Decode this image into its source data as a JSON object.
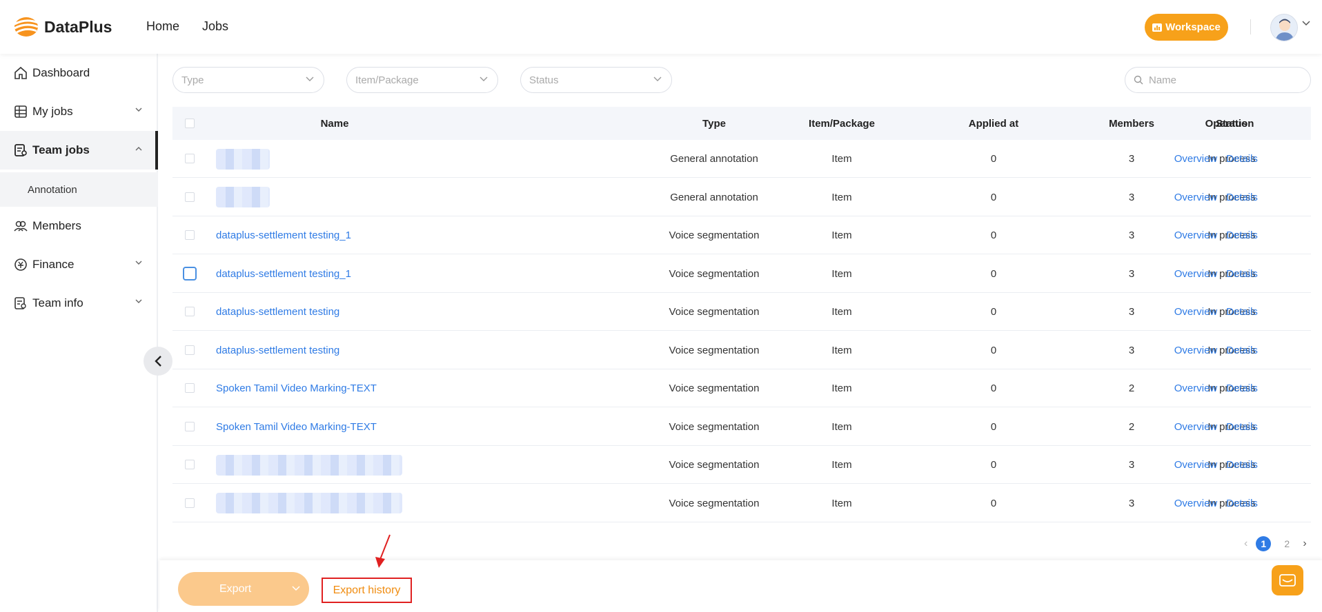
{
  "app": {
    "name": "DataPlus",
    "logo_icon": "dataplus-logo-icon"
  },
  "nav": {
    "home": "Home",
    "jobs": "Jobs"
  },
  "header": {
    "workspace": "Workspace",
    "accent_color": "#f7a11a"
  },
  "sidebar": {
    "dashboard": "Dashboard",
    "my_jobs": "My jobs",
    "team_jobs": "Team jobs",
    "annotation": "Annotation",
    "members": "Members",
    "finance": "Finance",
    "team_info": "Team info"
  },
  "filters": {
    "type": "Type",
    "item_package": "Item/Package",
    "status": "Status",
    "search_placeholder": "Name"
  },
  "table": {
    "headers": {
      "name": "Name",
      "type": "Type",
      "item_package": "Item/Package",
      "applied_at": "Applied at",
      "members": "Members",
      "status": "Status",
      "operation": "Operation"
    },
    "rows": [
      {
        "name": "",
        "type": "General annotation",
        "item": "Item",
        "applied": "0",
        "members": "3",
        "status": "In process",
        "overview": "Overview",
        "details": "Details"
      },
      {
        "name": "",
        "type": "General annotation",
        "item": "Item",
        "applied": "0",
        "members": "3",
        "status": "In process",
        "overview": "Overview",
        "details": "Details"
      },
      {
        "name": "dataplus-settlement testing_1",
        "type": "Voice segmentation",
        "item": "Item",
        "applied": "0",
        "members": "3",
        "status": "In process",
        "overview": "Overview",
        "details": "Details"
      },
      {
        "name": "dataplus-settlement testing_1",
        "type": "Voice segmentation",
        "item": "Item",
        "applied": "0",
        "members": "3",
        "status": "In process",
        "overview": "Overview",
        "details": "Details"
      },
      {
        "name": "dataplus-settlement testing",
        "type": "Voice segmentation",
        "item": "Item",
        "applied": "0",
        "members": "3",
        "status": "In process",
        "overview": "Overview",
        "details": "Details"
      },
      {
        "name": "dataplus-settlement testing",
        "type": "Voice segmentation",
        "item": "Item",
        "applied": "0",
        "members": "3",
        "status": "In process",
        "overview": "Overview",
        "details": "Details"
      },
      {
        "name": "Spoken Tamil Video Marking-TEXT",
        "type": "Voice segmentation",
        "item": "Item",
        "applied": "0",
        "members": "2",
        "status": "In process",
        "overview": "Overview",
        "details": "Details"
      },
      {
        "name": "Spoken Tamil Video Marking-TEXT",
        "type": "Voice segmentation",
        "item": "Item",
        "applied": "0",
        "members": "2",
        "status": "In process",
        "overview": "Overview",
        "details": "Details"
      },
      {
        "name": "",
        "type": "Voice segmentation",
        "item": "Item",
        "applied": "0",
        "members": "3",
        "status": "In process",
        "overview": "Overview",
        "details": "Details"
      },
      {
        "name": "",
        "type": "Voice segmentation",
        "item": "Item",
        "applied": "0",
        "members": "3",
        "status": "In process",
        "overview": "Overview",
        "details": "Details"
      }
    ]
  },
  "pagination": {
    "pages": [
      "1",
      "2"
    ],
    "current": "1"
  },
  "footer": {
    "export": "Export",
    "export_history": "Export history"
  }
}
